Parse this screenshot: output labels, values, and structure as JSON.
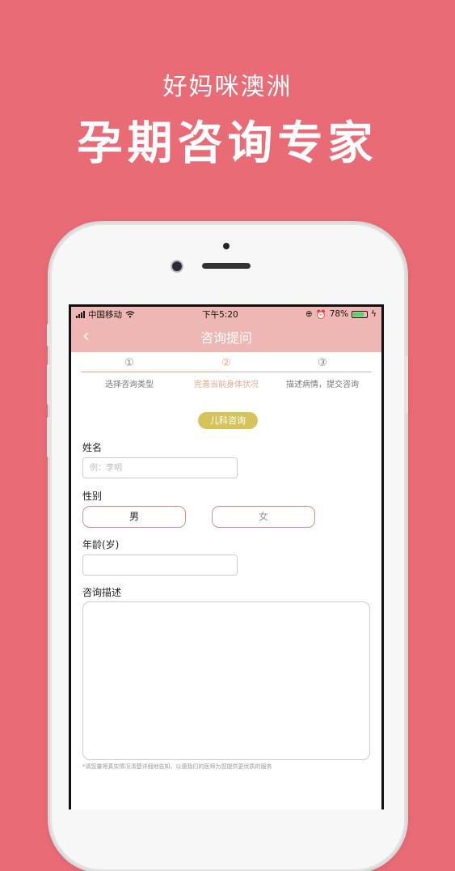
{
  "promo": {
    "subtitle": "好妈咪澳洲",
    "title": "孕期咨询专家"
  },
  "status_bar": {
    "carrier": "中国移动",
    "time": "下午5:20",
    "battery_percent": "78%",
    "battery_level": 0.78
  },
  "nav": {
    "back_icon": "‹",
    "title": "咨询提问"
  },
  "steps": [
    {
      "num": "①",
      "label": "选择咨询类型"
    },
    {
      "num": "②",
      "label": "完善当前身体状况"
    },
    {
      "num": "③",
      "label": "描述病情，提交咨询"
    }
  ],
  "active_step": 2,
  "category_tag": "儿科咨询",
  "form": {
    "name_label": "姓名",
    "name_placeholder": "例：李明",
    "name_value": "",
    "gender_label": "性别",
    "gender_male": "男",
    "gender_female": "女",
    "age_label": "年龄(岁)",
    "age_value": "",
    "desc_label": "咨询描述",
    "desc_value": "",
    "footnote": "*请您量将真实情况清楚详细地告知，以便我们的医师为您提供更优质的服务"
  },
  "colors": {
    "background": "#E96B76",
    "header": "#EFB7B3",
    "accent": "#E8A78C",
    "tag": "#D6C45B",
    "gender_border": "#D98C8C"
  }
}
